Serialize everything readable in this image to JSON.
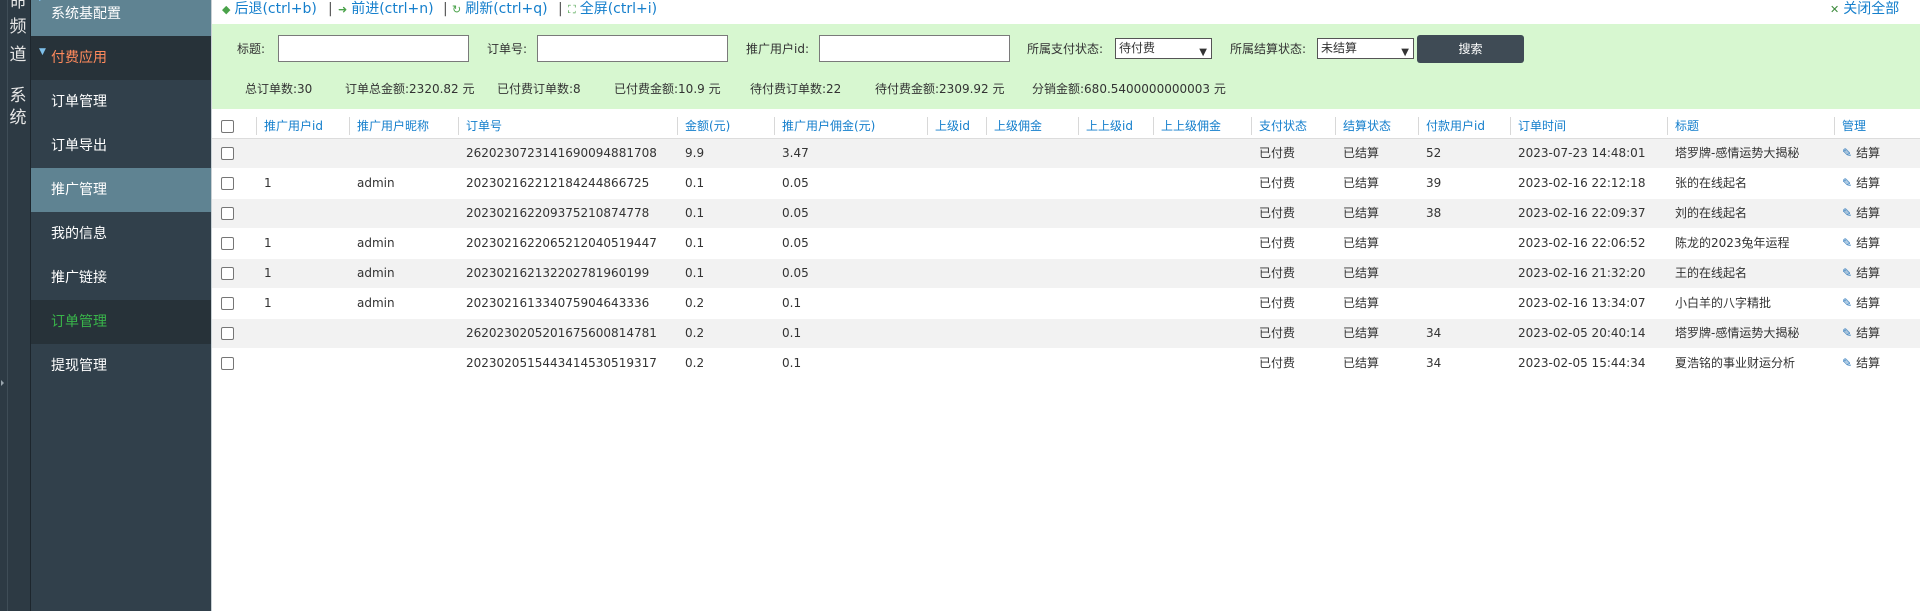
{
  "channel_strip": {
    "top_chars": [
      "命",
      "频",
      "道"
    ],
    "bottom_chars": [
      "系",
      "统"
    ]
  },
  "sidebar": {
    "items": [
      {
        "label": "系统基配置"
      },
      {
        "label": "付费应用"
      },
      {
        "label": "订单管理"
      },
      {
        "label": "订单导出"
      },
      {
        "label": "推广管理"
      },
      {
        "label": "我的信息"
      },
      {
        "label": "推广链接"
      },
      {
        "label": "订单管理"
      },
      {
        "label": "提现管理"
      }
    ]
  },
  "toolbar": {
    "back": "后退(ctrl+b)",
    "forward": "前进(ctrl+n)",
    "refresh": "刷新(ctrl+q)",
    "fullscreen": "全屏(ctrl+i)",
    "close_all": "关闭全部",
    "sep": "|"
  },
  "filters": {
    "title_label": "标题:",
    "order_no_label": "订单号:",
    "promoter_id_label": "推广用户id:",
    "pay_status_label": "所属支付状态:",
    "pay_status_value": "待付费",
    "settle_status_label": "所属结算状态:",
    "settle_status_value": "未结算",
    "search_button": "搜索",
    "title_value": "",
    "order_no_value": "",
    "promoter_id_value": ""
  },
  "stats": {
    "total_orders": "总订单数:30",
    "total_amount": "订单总金额:2320.82 元",
    "paid_orders": "已付费订单数:8",
    "paid_amount": "已付费金额:10.9 元",
    "unpaid_orders": "待付费订单数:22",
    "unpaid_amount": "待付费金额:2309.92 元",
    "dist_amount": "分销金额:680.5400000000003 元"
  },
  "table": {
    "headers": [
      "推广用户id",
      "推广用户昵称",
      "订单号",
      "金额(元)",
      "推广用户佣金(元)",
      "上级id",
      "上级佣金",
      "上上级id",
      "上上级佣金",
      "支付状态",
      "结算状态",
      "付款用户id",
      "订单时间",
      "标题",
      "管理"
    ],
    "rows": [
      [
        "",
        "",
        "26202307231416900948817 08",
        "9.9",
        "3.47",
        "",
        "",
        "",
        "",
        "已付费",
        "已结算",
        "52",
        "2023-07-23 14:48:01",
        "塔罗牌-感情运势大揭秘",
        "结算"
      ],
      [
        "1",
        "admin",
        "20230216221218424486672 5",
        "0.1",
        "0.05",
        "",
        "",
        "",
        "",
        "已付费",
        "已结算",
        "39",
        "2023-02-16 22:12:18",
        "张的在线起名",
        "结算"
      ],
      [
        "",
        "",
        "20230216220937521087477 8",
        "0.1",
        "0.05",
        "",
        "",
        "",
        "",
        "已付费",
        "已结算",
        "38",
        "2023-02-16 22:09:37",
        "刘的在线起名",
        "结算"
      ],
      [
        "1",
        "admin",
        "20230216220652120405194 47",
        "0.1",
        "0.05",
        "",
        "",
        "",
        "",
        "已付费",
        "已结算",
        "",
        "2023-02-16 22:06:52",
        "陈龙的2023兔年运程",
        "结算"
      ],
      [
        "1",
        "admin",
        "20230216213220278196019 9",
        "0.1",
        "0.05",
        "",
        "",
        "",
        "",
        "已付费",
        "已结算",
        "",
        "2023-02-16 21:32:20",
        "王的在线起名",
        "结算"
      ],
      [
        "1",
        "admin",
        "20230216133407590464333 6",
        "0.2",
        "0.1",
        "",
        "",
        "",
        "",
        "已付费",
        "已结算",
        "",
        "2023-02-16 13:34:07",
        "小白羊的八字精批",
        "结算"
      ],
      [
        "",
        "",
        "26202302052016756008147 81",
        "0.2",
        "0.1",
        "",
        "",
        "",
        "",
        "已付费",
        "已结算",
        "34",
        "2023-02-05 20:40:14",
        "塔罗牌-感情运势大揭秘",
        "结算"
      ],
      [
        "",
        "",
        "20230205154434145305193 17",
        "0.2",
        "0.1",
        "",
        "",
        "",
        "",
        "已付费",
        "已结算",
        "34",
        "2023-02-05 15:44:34",
        "夏浩铭的事业财运分析",
        "结算"
      ]
    ]
  },
  "icons": {
    "back": "arrow-left-icon",
    "forward": "arrow-right-icon",
    "refresh": "refresh-icon",
    "fullscreen": "fullscreen-icon",
    "close": "close-icon",
    "edit": "pencil-icon"
  },
  "colors": {
    "link": "#157fcc",
    "filter_bg": "#d7f7d0",
    "sidebar_bg": "#31404b",
    "active_green": "#39b54a",
    "accent_orange": "#ff8a5c"
  }
}
